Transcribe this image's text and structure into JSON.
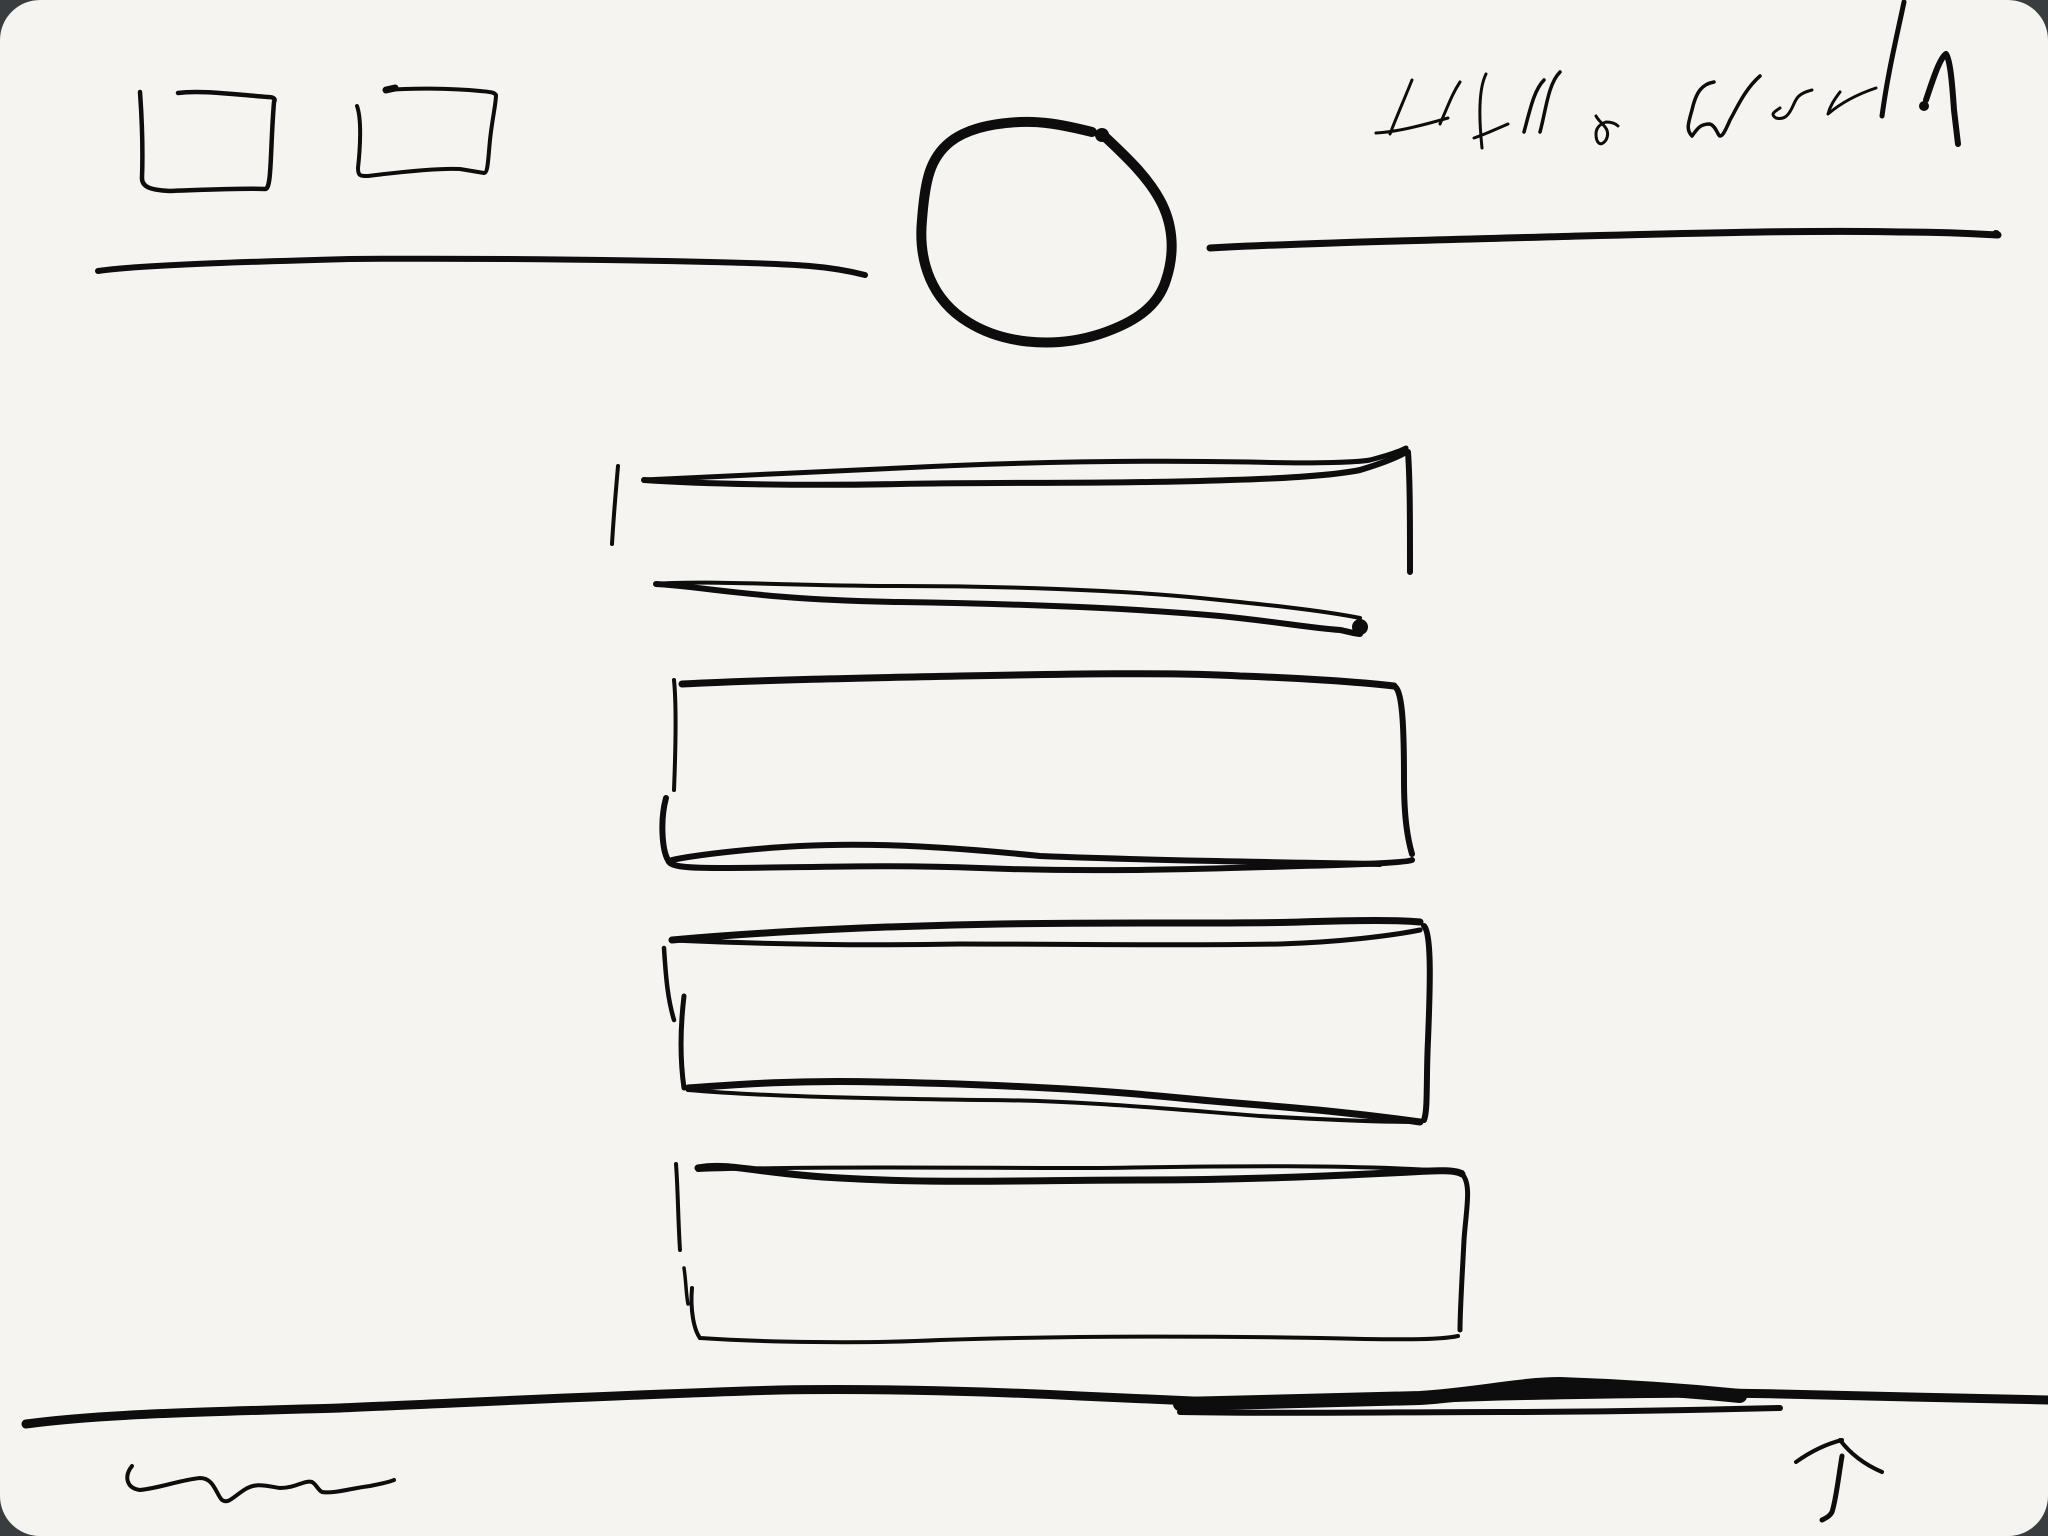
{
  "canvas": {
    "background_color": "#f5f4f0",
    "ink_color": "#0d0d0d",
    "frame_color": "#3a3d40"
  },
  "header": {
    "handwritten_text": "Hello World",
    "left_icons": [
      "sketch-box-1",
      "sketch-box-2"
    ],
    "center_avatar": "circle-avatar"
  },
  "content": {
    "heading_placeholder_count": 1,
    "card_placeholder_count": 3
  },
  "footer": {
    "left_glyph": "squiggle",
    "right_glyph": "up-arrow"
  }
}
